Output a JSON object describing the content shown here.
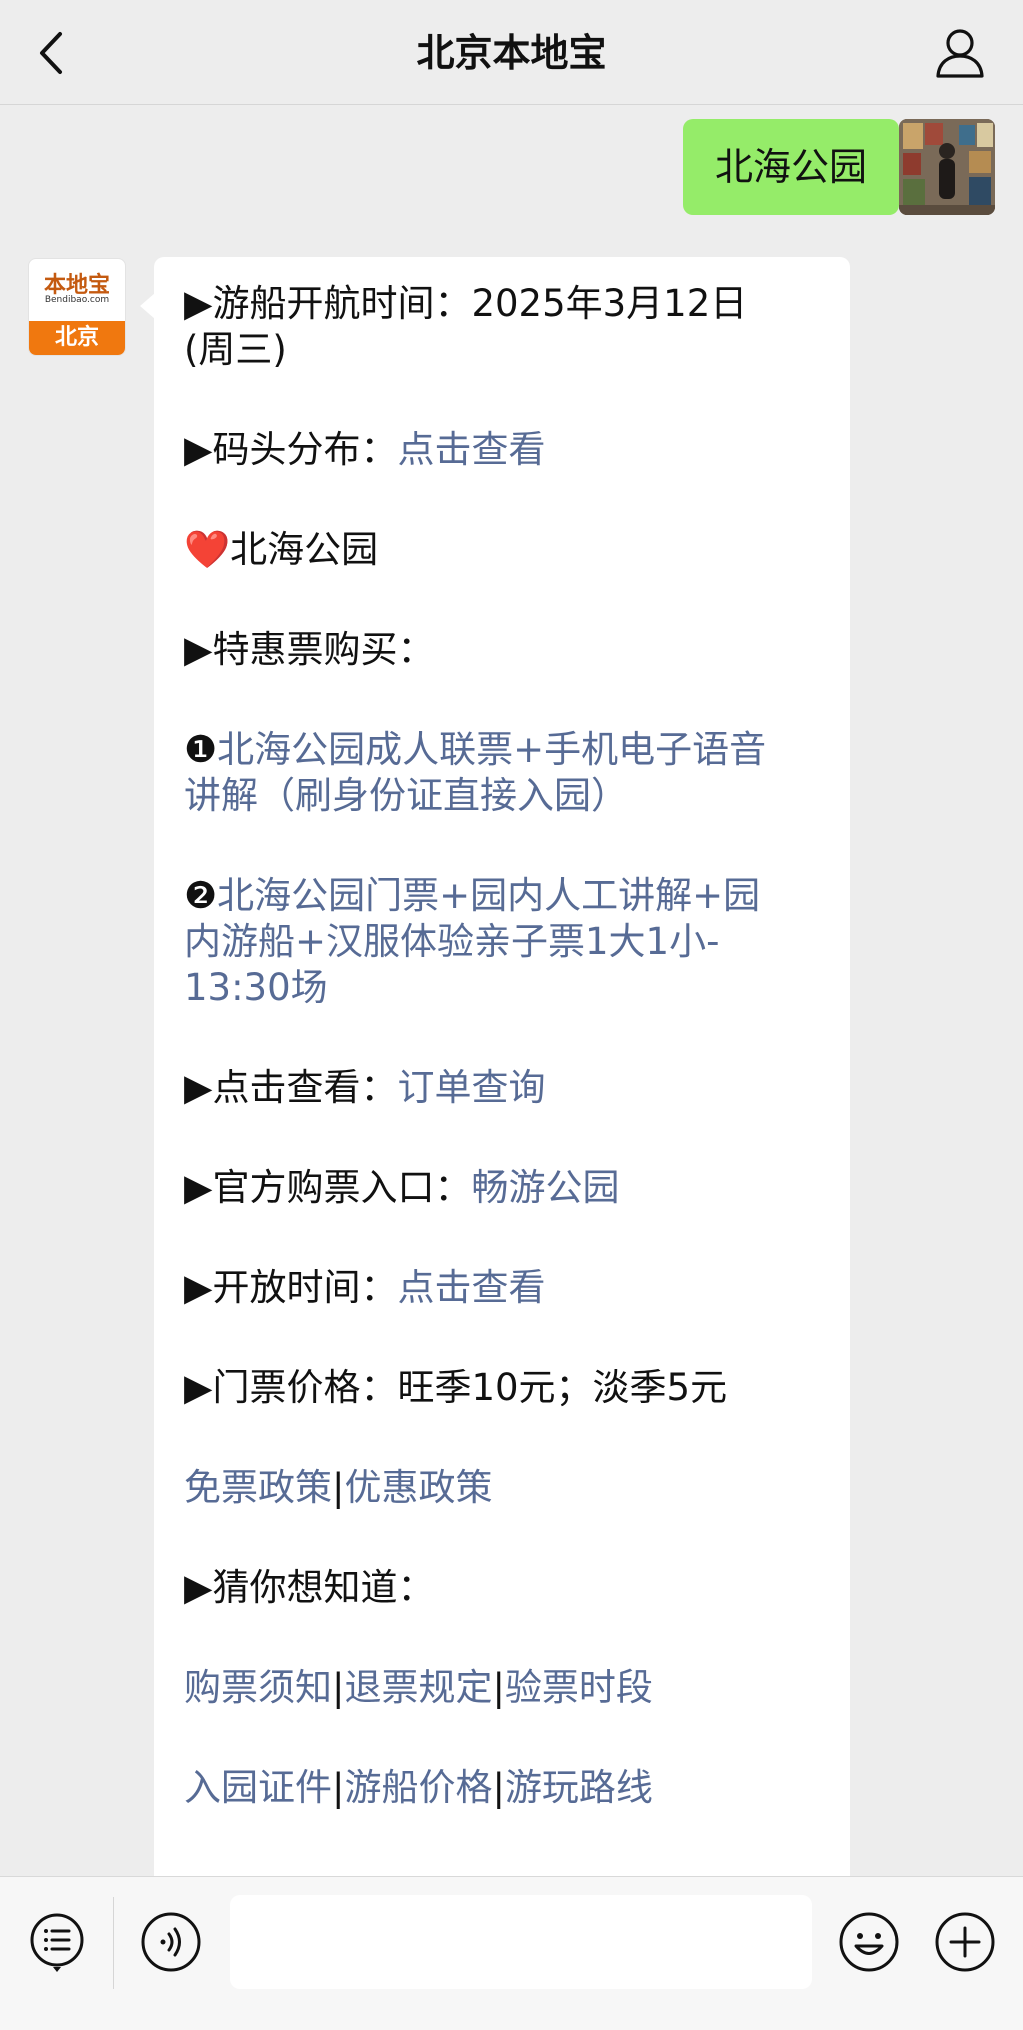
{
  "header": {
    "title": "北京本地宝"
  },
  "icons": {
    "back": "chevron-left-icon",
    "profile": "person-icon",
    "menu": "list-menu-icon",
    "voice": "voice-icon",
    "emoji": "smile-icon",
    "more": "plus-icon"
  },
  "colors": {
    "sent_bubble": "#95ec69",
    "link": "#576b95",
    "bot_brand": "#f0780f"
  },
  "sent_message": {
    "text": "北海公园"
  },
  "bot_avatar": {
    "logo_top": "本地宝",
    "logo_small": "Bendibao.com",
    "logo_city": "北京"
  },
  "reply": {
    "sail_time_prefix": "▶游船开航时间：2025年3月12日",
    "sail_time_suffix": "(周三)",
    "pier_prefix": "▶码头分布：",
    "pier_link": "点击查看",
    "heart": "❤️",
    "park_name": "北海公园",
    "discount_title": "▶特惠票购买：",
    "item1_num": "❶",
    "item1_line1": "北海公园成人联票+手机电子语音",
    "item1_line2": "讲解（刷身份证直接入园）",
    "item2_num": "❷",
    "item2_line1": "北海公园门票+园内人工讲解+园",
    "item2_line2": "内游船+汉服体验亲子票1大1小-",
    "item2_line3": "13:30场",
    "order_prefix": "▶点击查看：",
    "order_link": "订单查询",
    "official_prefix": "▶官方购票入口：",
    "official_link": "畅游公园",
    "hours_prefix": "▶开放时间：",
    "hours_link": "点击查看",
    "price_line": "▶门票价格：旺季10元；淡季5元",
    "policy_link1": "免票政策",
    "policy_link2": "优惠政策",
    "guess_title": "▶猜你想知道：",
    "guess_row1": [
      "购票须知",
      "退票规定",
      "验票时段"
    ],
    "guess_row2": [
      "入园证件",
      "游船价格",
      "游玩路线"
    ],
    "separator": "|"
  },
  "input": {
    "value": "",
    "placeholder": ""
  }
}
